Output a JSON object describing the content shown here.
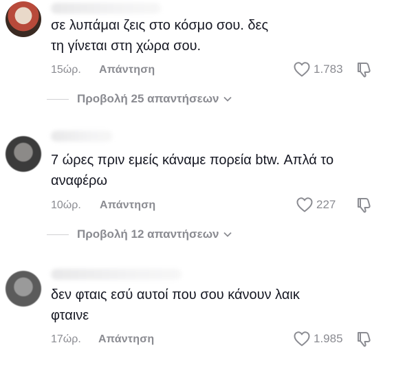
{
  "comments": [
    {
      "text": "σε λυπάμαι ζεις στο κόσμο σου. δες τη γίνεται στη χώρα σου.",
      "time": "15ώρ.",
      "reply_label": "Απάντηση",
      "likes": "1.783",
      "view_replies": "Προβολή 25 απαντήσεων"
    },
    {
      "text": "7 ώρες πριν εμείς κάναμε πορεία btw. Απλά το αναφέρω",
      "time": "10ώρ.",
      "reply_label": "Απάντηση",
      "likes": "227",
      "view_replies": "Προβολή 12 απαντήσεων"
    },
    {
      "text": "δεν φταις εσύ αυτοί που σου κάνουν λαικ φταινε",
      "time": "17ώρ.",
      "reply_label": "Απάντηση",
      "likes": "1.985"
    }
  ],
  "icons": {
    "heart": "heart-outline-icon",
    "dislike": "thumbs-down-outline-icon",
    "chevron": "chevron-down-icon"
  },
  "colors": {
    "text": "#161823",
    "muted": "#8a8b91"
  }
}
